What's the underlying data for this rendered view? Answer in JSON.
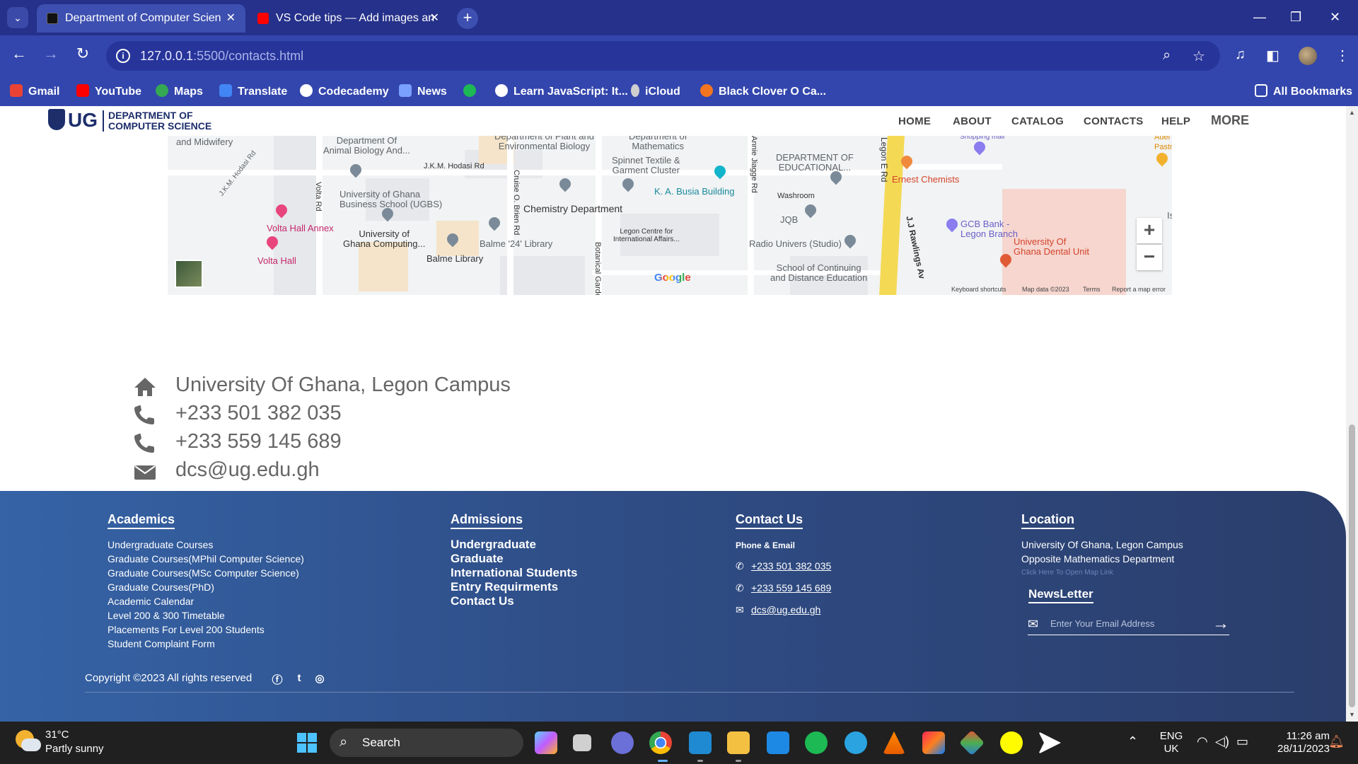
{
  "browser": {
    "tabs": [
      {
        "title": "Department of Computer Scien",
        "active": true
      },
      {
        "title": "VS Code tips — Add images an",
        "active": false
      }
    ],
    "close_glyph": "✕",
    "new_tab_glyph": "+",
    "url_host": "127.0.0.1",
    "url_path": ":5500/contacts.html",
    "bookmarks": [
      "Gmail",
      "YouTube",
      "Maps",
      "Translate",
      "Codecademy",
      "News",
      "",
      "Learn JavaScript: It...",
      "iCloud",
      "Black Clover O Ca..."
    ],
    "all_bookmarks": "All Bookmarks"
  },
  "site": {
    "logo_ug": "UG",
    "logo_line1": "DEPARTMENT OF",
    "logo_line2": "COMPUTER SCIENCE",
    "nav": [
      "HOME",
      "ABOUT",
      "CATALOG",
      "CONTACTS",
      "HELP"
    ],
    "nav_more": "MORE"
  },
  "map": {
    "labels": {
      "midwifery": "and Midwifery",
      "animal_bio": "Department Of\nAnimal Biology And...",
      "plant_bio": "Department of Plant and\nEnvironmental Biology",
      "maths": "Department of\nMathematics",
      "hodasi_rd": "J.K.M. Hodasi Rd",
      "hodasi_rd2": "J.K.M. Hodasi Rd",
      "ugbs": "University of Ghana\nBusiness School (UGBS)",
      "volta_rd": "Volta Rd",
      "cruise_rd": "Cruise O. Brien Rd",
      "spinnet": "Spinnet Textile &\nGarment Cluster",
      "busia": "K. A. Busia Building",
      "jiagge_rd": "Annie Jiagge Rd",
      "dept_edu": "DEPARTMENT OF\nEDUCATIONAL...",
      "legon_rd": "Legon E Rd",
      "ernest": "Ernest Chemists",
      "shopping": "Shopping mall",
      "washroom": "Washroom",
      "chemistry": "Chemistry Department",
      "volta_annex": "Volta Hall Annex",
      "ug_computing": "University of\nGhana Computing...",
      "balme24": "Balme '24' Library",
      "legon_centre": "Legon Centre for\nInternational Affairs...",
      "jqb": "JQB",
      "rawlings": "J.J Rawlings Av",
      "gcb": "GCB Bank -\nLegon Branch",
      "dental": "University Of\nGhana Dental Unit",
      "radio": "Radio Univers (Studio)",
      "volta_hall": "Volta Hall",
      "balme_library": "Balme Library",
      "botanical": "Botanical Garde",
      "continuing": "School of Continuing\nand Distance Education",
      "acer": "Adei\nPastr",
      "is": "Is"
    },
    "google": "Google",
    "footer": [
      "Keyboard shortcuts",
      "Map data ©2023",
      "Terms",
      "Report a map error"
    ],
    "zoom_in": "+",
    "zoom_out": "−"
  },
  "contact_info": [
    {
      "icon": "home-icon",
      "text": "University Of Ghana, Legon Campus"
    },
    {
      "icon": "phone-icon",
      "text": "+233 501 382 035"
    },
    {
      "icon": "phone-icon",
      "text": "+233 559 145 689"
    },
    {
      "icon": "envelope-icon",
      "text": "dcs@ug.edu.gh"
    }
  ],
  "footer": {
    "academics": {
      "heading": "Academics",
      "items": [
        "Undergraduate Courses",
        "Graduate Courses(MPhil Computer Science)",
        "Graduate Courses(MSc Computer Science)",
        "Graduate Courses(PhD)",
        "Academic Calendar",
        "Level 200 & 300 Timetable",
        "Placements For Level 200 Students",
        "Student Complaint Form"
      ]
    },
    "admissions": {
      "heading": "Admissions",
      "items": [
        "Undergraduate",
        "Graduate",
        "International Students",
        "Entry Requirments",
        "Contact Us"
      ]
    },
    "contact": {
      "heading": "Contact Us",
      "sub": "Phone & Email",
      "items": [
        "+233 501 382 035",
        "+233 559 145 689",
        "dcs@ug.edu.gh"
      ]
    },
    "location": {
      "heading": "Location",
      "line1": "University Of Ghana, Legon Campus",
      "line2": "Opposite Mathematics Department",
      "map_link": "Click Here To Open Map Link",
      "news_heading": "NewsLetter",
      "email_placeholder": "Enter Your Email Address"
    },
    "copyright": "Copyright ©2023 All rights reserved"
  },
  "taskbar": {
    "temp": "31°C",
    "weather": "Partly sunny",
    "search": "Search",
    "lang1": "ENG",
    "lang2": "UK",
    "time": "11:26 am",
    "date": "28/11/2023"
  }
}
